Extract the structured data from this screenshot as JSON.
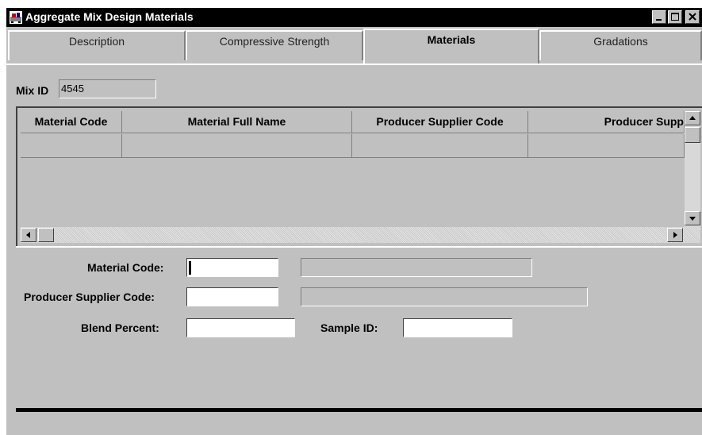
{
  "window": {
    "title": "Aggregate Mix Design Materials",
    "icon": "app-icon",
    "controls": [
      "minimize-icon",
      "maximize-icon",
      "close-icon"
    ]
  },
  "tabs": [
    {
      "label": "Description",
      "active": false
    },
    {
      "label": "Compressive Strength",
      "active": false
    },
    {
      "label": "Materials",
      "active": true
    },
    {
      "label": "Gradations",
      "active": false
    }
  ],
  "mix": {
    "label": "Mix ID",
    "value": "4545"
  },
  "grid": {
    "columns": [
      "Material Code",
      "Material Full Name",
      "Producer Supplier Code",
      "Producer Supp"
    ],
    "rows": [
      [
        "",
        "",
        "",
        ""
      ]
    ]
  },
  "detail": {
    "material_code_label": "Material Code:",
    "material_code_value": "",
    "material_name_value": "",
    "producer_code_label": "Producer Supplier Code:",
    "producer_code_value": "",
    "producer_name_value": "",
    "blend_label": "Blend Percent:",
    "blend_value": "",
    "sample_label": "Sample ID:",
    "sample_value": ""
  }
}
